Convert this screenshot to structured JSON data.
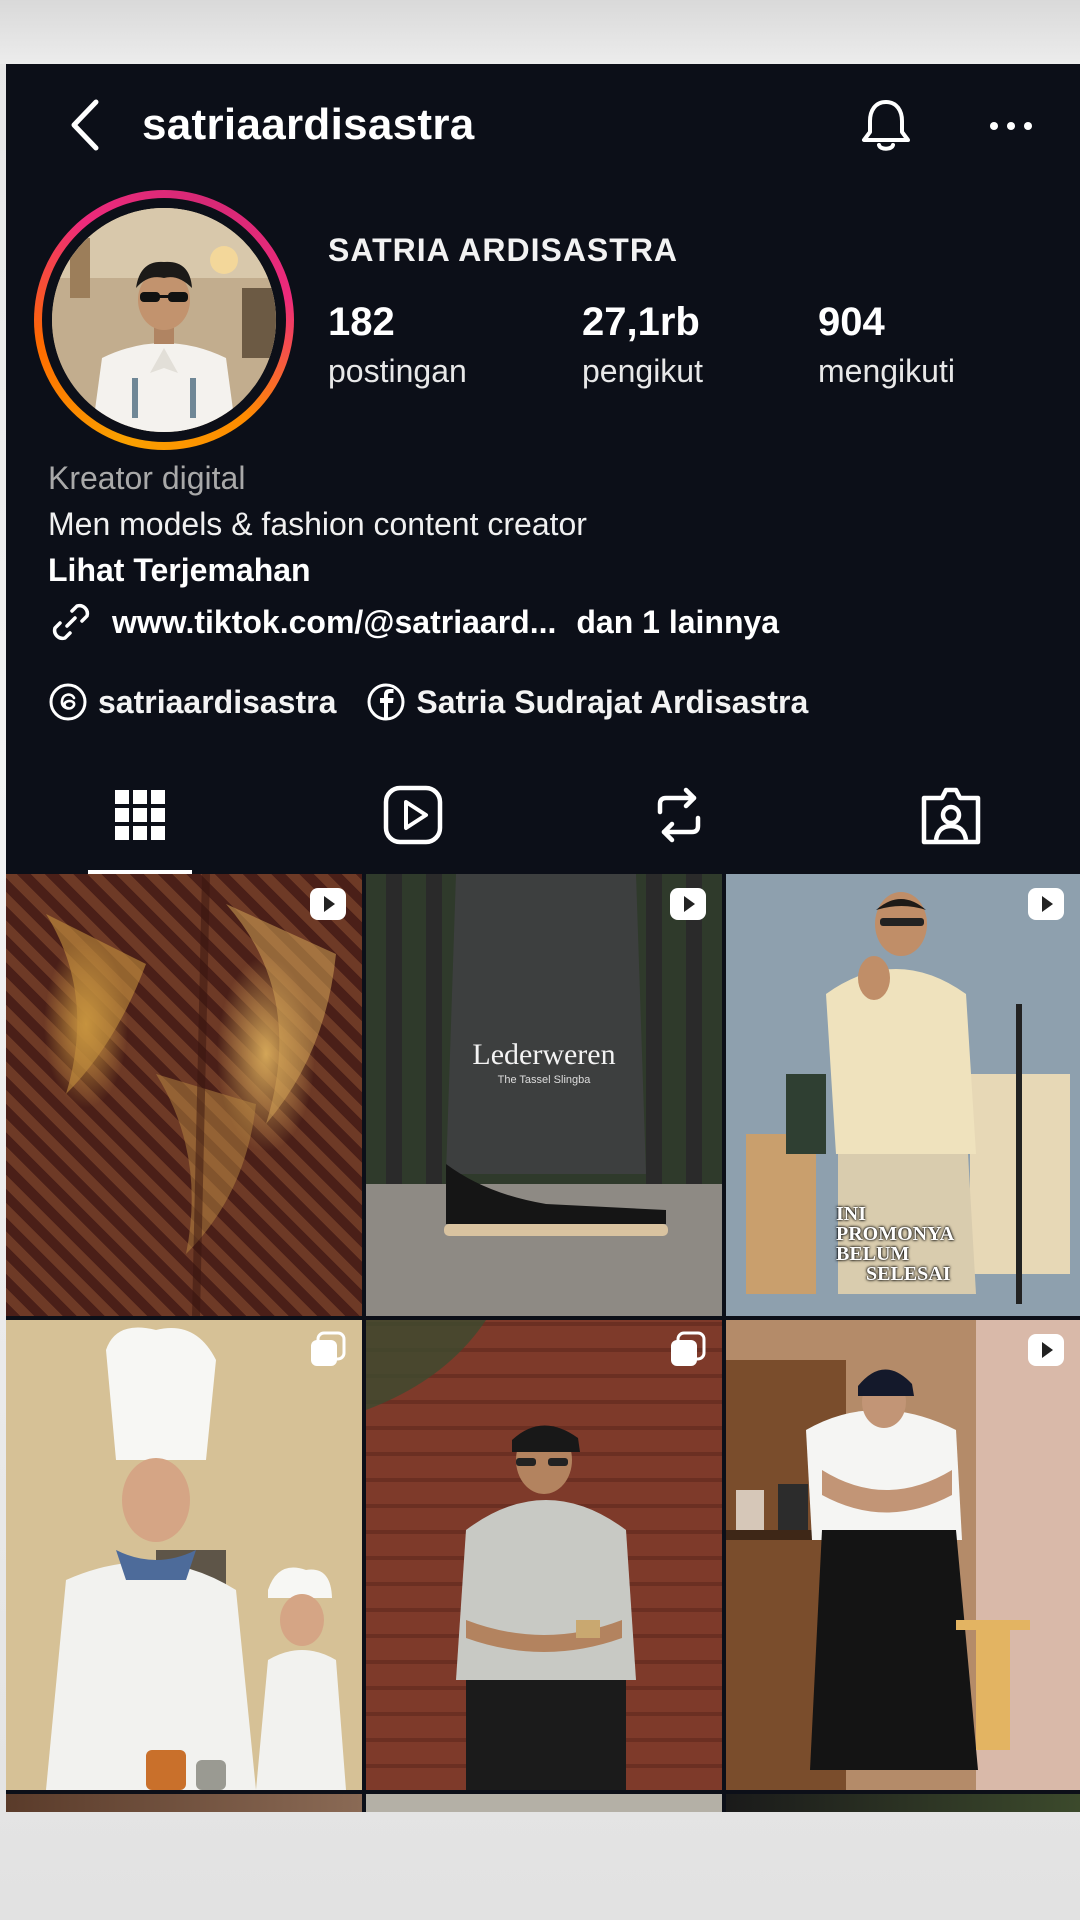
{
  "header": {
    "username": "satriaardisastra"
  },
  "profile": {
    "display_name": "SATRIA ARDISASTRA",
    "stats": [
      {
        "value": "182",
        "label": "postingan"
      },
      {
        "value": "27,1rb",
        "label": "pengikut"
      },
      {
        "value": "904",
        "label": "mengikuti"
      }
    ],
    "category": "Kreator digital",
    "bio": "Men models & fashion content creator",
    "translate": "Lihat Terjemahan",
    "link": "www.tiktok.com/@satriaard...",
    "link_more": "dan 1 lainnya",
    "threads_handle": "satriaardisastra",
    "facebook_name": "Satria Sudrajat Ardisastra"
  },
  "tabs": [
    {
      "icon": "grid-icon",
      "active": true
    },
    {
      "icon": "reels-icon",
      "active": false
    },
    {
      "icon": "repost-icon",
      "active": false
    },
    {
      "icon": "tagged-icon",
      "active": false
    }
  ],
  "posts": [
    {
      "badge": "reel-icon",
      "overlay": ""
    },
    {
      "badge": "reel-icon",
      "overlay_title": "Lederweren",
      "overlay_sub": "The Tassel Slingba"
    },
    {
      "badge": "reel-icon",
      "overlay_lines": [
        "INI",
        "PROMONYA",
        "BELUM",
        "SELESAI"
      ]
    },
    {
      "badge": "carousel-icon"
    },
    {
      "badge": "carousel-icon"
    },
    {
      "badge": "reel-icon"
    }
  ],
  "colors": {
    "background": "#0c0f18",
    "text": "#ffffff",
    "muted": "#a9a9a9",
    "ring_start": "#f9a000",
    "ring_end": "#ee2a7b"
  }
}
